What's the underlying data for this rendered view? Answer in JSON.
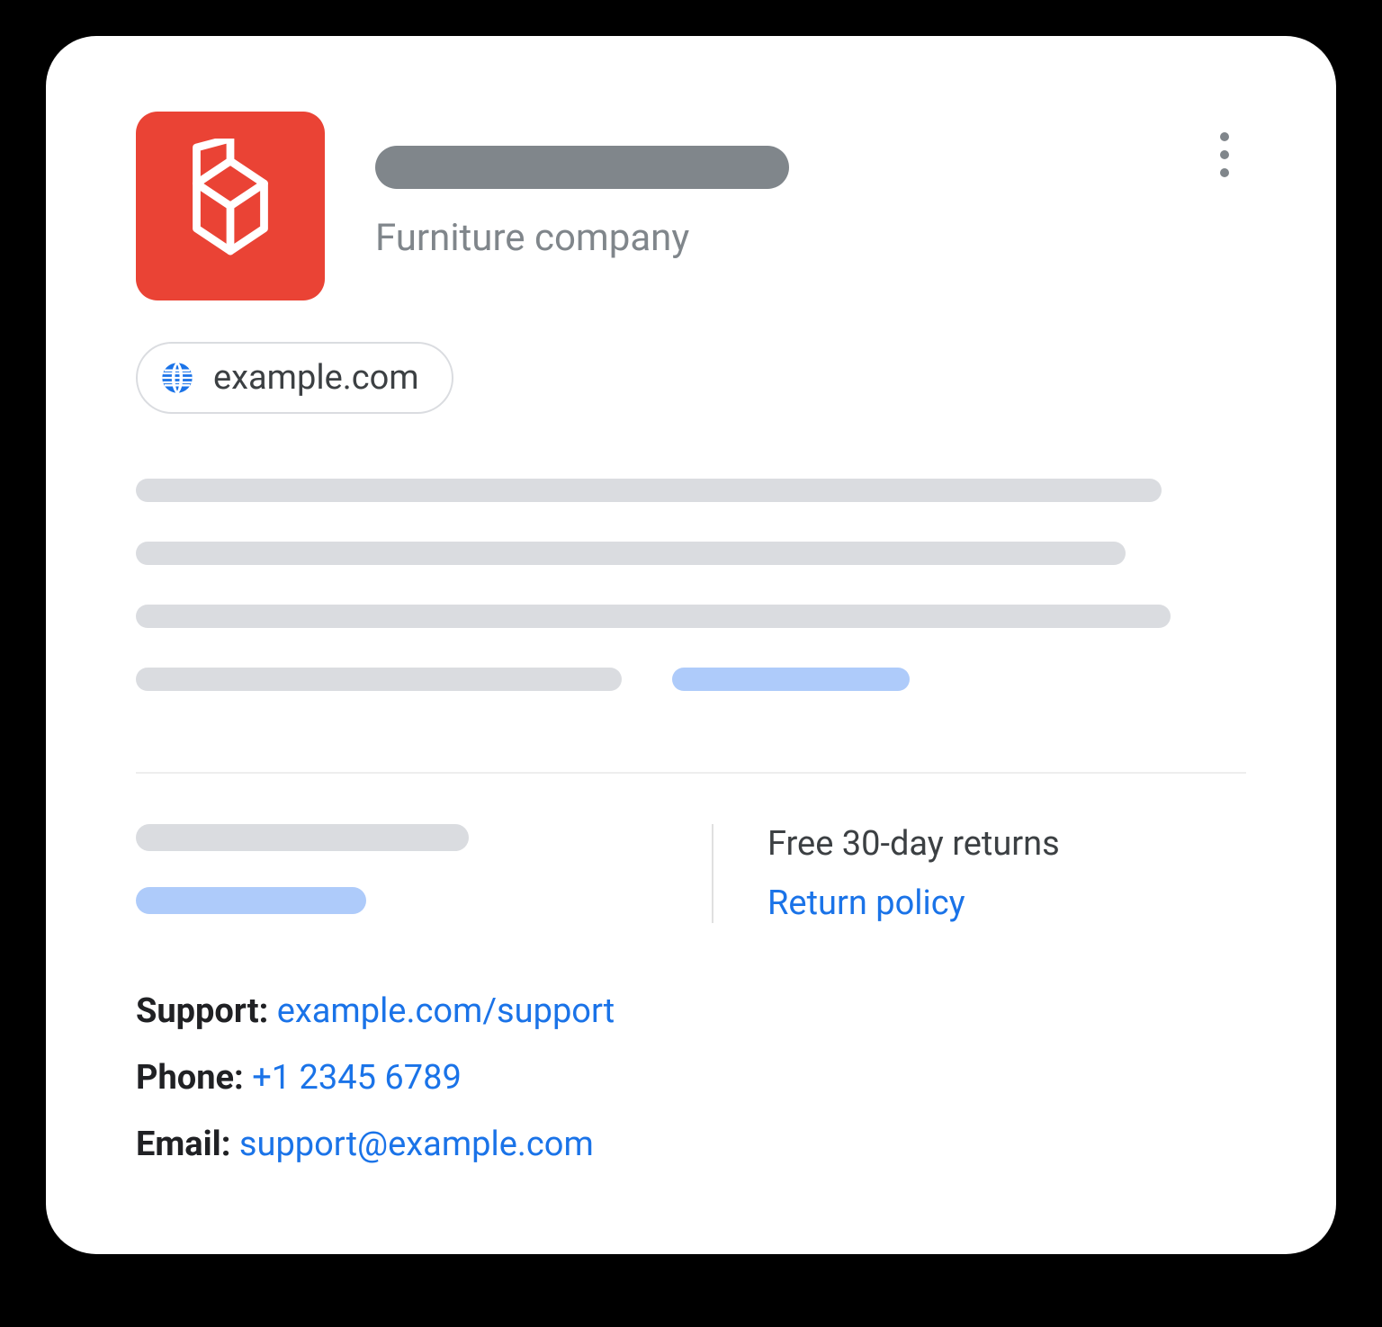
{
  "header": {
    "subtitle": "Furniture company",
    "logo_color": "#EA4335"
  },
  "domain_chip": {
    "label": "example.com"
  },
  "returns": {
    "headline": "Free 30-day returns",
    "policy_link": "Return policy"
  },
  "contact": {
    "support_label": "Support: ",
    "support_link": "example.com/support",
    "phone_label": "Phone: ",
    "phone_link": "+1 2345 6789",
    "email_label": "Email: ",
    "email_link": "support@example.com"
  },
  "colors": {
    "link": "#1A73E8",
    "placeholder_grey": "#DADCE0",
    "placeholder_blue": "#AECBFA",
    "text_muted": "#80868B"
  }
}
